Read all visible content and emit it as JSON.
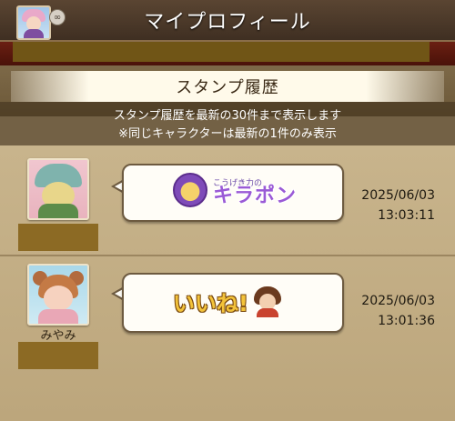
{
  "header": {
    "title": "マイプロフィール",
    "link_icon": "link-icon"
  },
  "section": {
    "title": "スタンプ履歴"
  },
  "info": {
    "line1": "スタンプ履歴を最新の30件まで表示します",
    "line2": "※同じキャラクターは最新の1件のみ表示"
  },
  "history": [
    {
      "name": "",
      "stamp_small_text": "こうげき力の",
      "stamp_big_text": "キラポン",
      "date": "2025/06/03",
      "time": "13:03:11"
    },
    {
      "name": "みやみ",
      "stamp_text": "いいね!",
      "date": "2025/06/03",
      "time": "13:01:36"
    }
  ],
  "colors": {
    "topbar": "#4a3828",
    "band": "#5a180c",
    "redaction": "#8c6a24",
    "bubble_border": "#6d5a40"
  }
}
